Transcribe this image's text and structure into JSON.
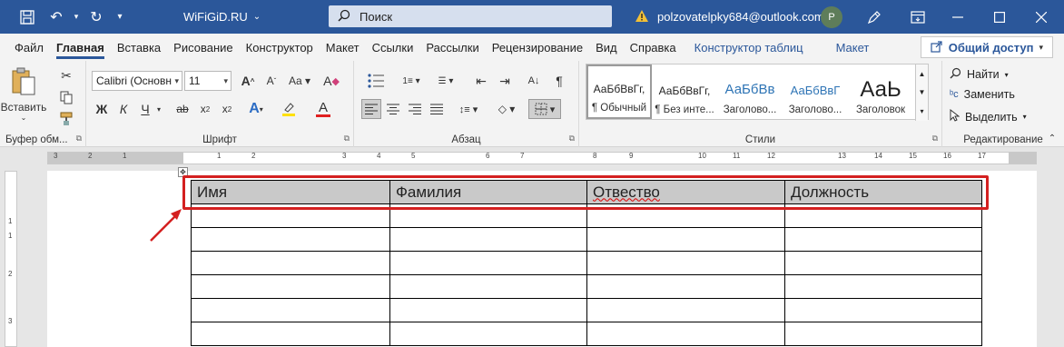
{
  "titlebar": {
    "doc_title": "WiFiGiD.RU",
    "search_placeholder": "Поиск",
    "account_email": "polzovatelpky684@outlook.com",
    "avatar_initial": "P",
    "brand_color": "#2b579a"
  },
  "menu": {
    "tabs": [
      "Файл",
      "Главная",
      "Вставка",
      "Рисование",
      "Конструктор",
      "Макет",
      "Ссылки",
      "Рассылки",
      "Рецензирование",
      "Вид",
      "Справка",
      "Конструктор таблиц",
      "Макет"
    ],
    "active_tab": "Главная",
    "share_label": "Общий доступ"
  },
  "ribbon": {
    "clipboard": {
      "paste_label": "Вставить",
      "group_label": "Буфер обм..."
    },
    "font": {
      "font_name": "Calibri (Основн",
      "font_size": "11",
      "group_label": "Шрифт",
      "bold": "Ж",
      "italic": "К",
      "underline": "Ч"
    },
    "paragraph": {
      "group_label": "Абзац"
    },
    "styles": {
      "group_label": "Стили",
      "items": [
        {
          "sample": "АаБбВвГг,",
          "name": "¶ Обычный"
        },
        {
          "sample": "АаБбВвГг,",
          "name": "¶ Без инте..."
        },
        {
          "sample": "АаБбВв",
          "name": "Заголово..."
        },
        {
          "sample": "АаБбВвГ",
          "name": "Заголово..."
        },
        {
          "sample": "АаЬ",
          "name": "Заголовок"
        }
      ]
    },
    "editing": {
      "group_label": "Редактирование",
      "find": "Найти",
      "replace": "Заменить",
      "select": "Выделить"
    }
  },
  "ruler": {
    "h_labels": [
      "3",
      "2",
      "1",
      "1",
      "2",
      "3",
      "4",
      "5",
      "6",
      "7",
      "8",
      "9",
      "10",
      "11",
      "12",
      "13",
      "14",
      "15",
      "16",
      "17"
    ],
    "v_labels": [
      "1",
      "1",
      "2",
      "3"
    ]
  },
  "table": {
    "headers": [
      "Имя",
      "Фамилия",
      "Отвество",
      "Должность"
    ],
    "empty_rows": 6,
    "header_fill": "#c9c9c9"
  },
  "annotation": {
    "highlight_color": "#d42020"
  }
}
